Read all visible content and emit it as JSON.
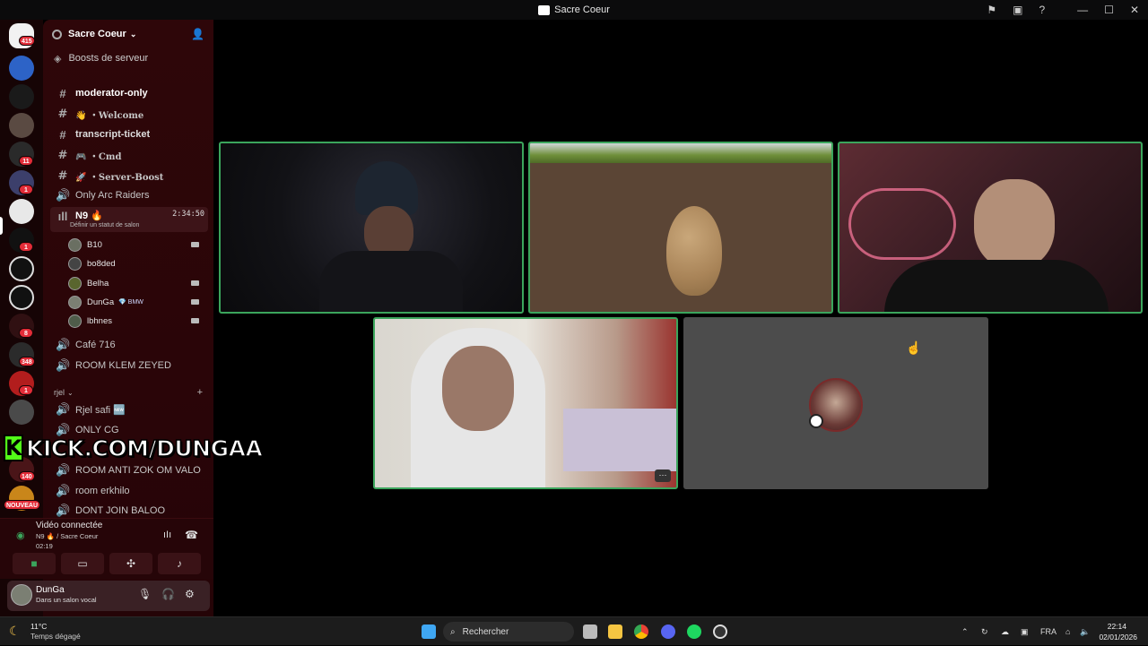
{
  "window": {
    "title": "Sacre Coeur"
  },
  "rail": {
    "badges": [
      "415",
      "11",
      "1",
      "1",
      "8",
      "348",
      "1",
      "140",
      "NOUVEAU"
    ]
  },
  "server": {
    "name": "Sacre Coeur",
    "boosts_label": "Boosts de serveur"
  },
  "channels": [
    {
      "label": "moderator-only"
    },
    {
      "label": "👋 ・Welcome"
    },
    {
      "label": "transcript-ticket"
    },
    {
      "label": "🎮 ・Cmd"
    },
    {
      "label": "🚀 ・Server-Boost"
    },
    {
      "label": "Only Arc Raiders"
    }
  ],
  "active_voice": {
    "name": "N9 🔥",
    "timer": "2:34:50",
    "status_hint": "Définir un statut de salon"
  },
  "voice_users": [
    {
      "name": "B10"
    },
    {
      "name": "bo8ded"
    },
    {
      "name": "Belha"
    },
    {
      "name": "DunGa",
      "tag": "💎 BMW"
    },
    {
      "name": "lbhnes"
    }
  ],
  "more_channels": [
    {
      "label": "Café 716"
    },
    {
      "label": "ROOM KLEM ZEYED"
    }
  ],
  "category": {
    "name": "rjel"
  },
  "category_channels": [
    {
      "label": "Rjel safi 🆕"
    },
    {
      "label": "ONLY CG"
    },
    {
      "label": "ROOM ANTI ZOK OM VALO"
    },
    {
      "label": "room erkhilo"
    },
    {
      "label": "DONT JOIN BALOO"
    }
  ],
  "overlay": {
    "kick_text": "KICK.COM/DUNGAA"
  },
  "voice_panel": {
    "status": "Vidéo connectée",
    "channel": "N9 🔥 / Sacre Coeur",
    "elapsed": "02:19"
  },
  "user_panel": {
    "name": "DunGa",
    "status": "Dans un salon vocal"
  },
  "taskbar": {
    "weather_temp": "11°C",
    "weather_desc": "Temps dégagé",
    "search_placeholder": "Rechercher",
    "lang": "FRA",
    "time": "22:14",
    "date": "02/01/2026"
  },
  "colors": {
    "accent_green": "#3ba55c",
    "danger": "#e22c38",
    "kick_green": "#53fc18"
  }
}
